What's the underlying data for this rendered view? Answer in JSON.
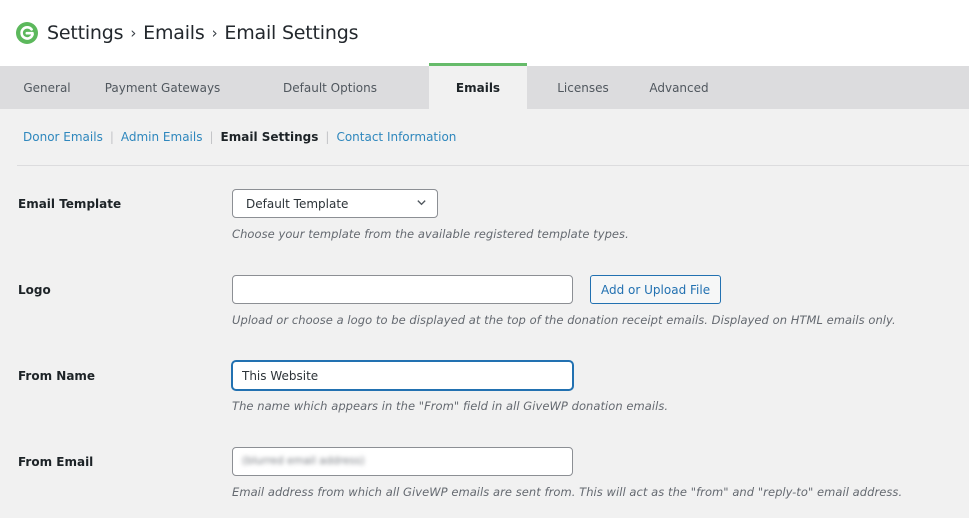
{
  "header": {
    "logo_icon": "givewp-logo-icon",
    "breadcrumb": [
      "Settings",
      "Emails",
      "Email Settings"
    ],
    "separator": "›",
    "brand_color": "#5cb85c"
  },
  "tabs": [
    {
      "label": "General",
      "active": false
    },
    {
      "label": "Payment Gateways",
      "active": false
    },
    {
      "label": "Default Options",
      "active": false
    },
    {
      "label": "Emails",
      "active": true
    },
    {
      "label": "Licenses",
      "active": false
    },
    {
      "label": "Advanced",
      "active": false
    }
  ],
  "active_tab_accent": "#66bb6a",
  "subnav": {
    "items": [
      {
        "label": "Donor Emails",
        "current": false
      },
      {
        "label": "Admin Emails",
        "current": false
      },
      {
        "label": "Email Settings",
        "current": true
      },
      {
        "label": "Contact Information",
        "current": false
      }
    ],
    "divider": "|"
  },
  "form": {
    "email_template": {
      "label": "Email Template",
      "selected": "Default Template",
      "description": "Choose your template from the available registered template types."
    },
    "logo": {
      "label": "Logo",
      "value": "",
      "button_label": "Add or Upload File",
      "description": "Upload or choose a logo to be displayed at the top of the donation receipt emails. Displayed on HTML emails only."
    },
    "from_name": {
      "label": "From Name",
      "value": "This Website",
      "description": "The name which appears in the \"From\" field in all GiveWP donation emails."
    },
    "from_email": {
      "label": "From Email",
      "value": "(blurred email address)",
      "description": "Email address from which all GiveWP emails are sent from. This will act as the \"from\" and \"reply-to\" email address."
    }
  }
}
